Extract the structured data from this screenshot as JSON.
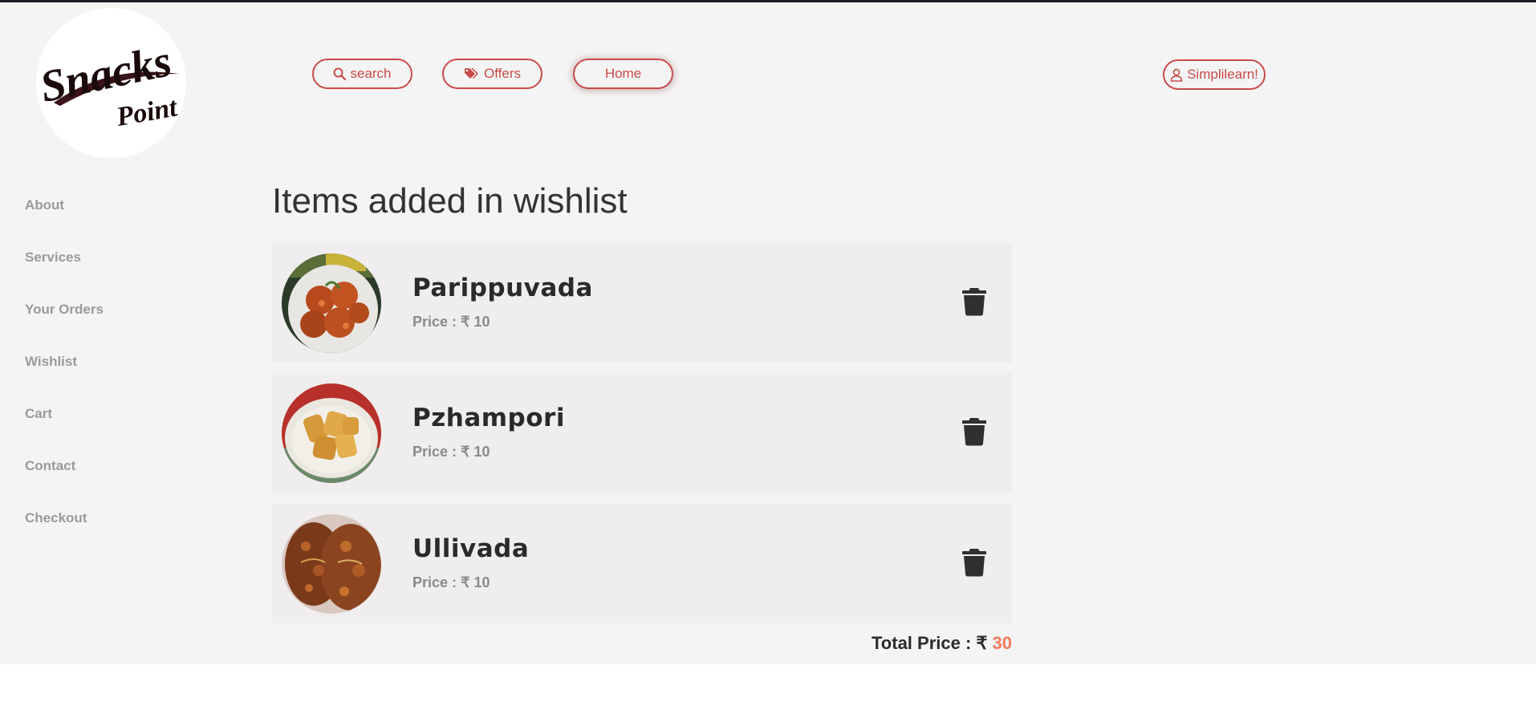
{
  "logo": {
    "line1": "Snacks",
    "line2": "Point"
  },
  "nav": {
    "search_label": "search",
    "offers_label": "Offers",
    "home_label": "Home",
    "user_label": "Simplilearn!"
  },
  "sidebar": {
    "items": [
      {
        "label": "About"
      },
      {
        "label": "Services"
      },
      {
        "label": "Your Orders"
      },
      {
        "label": "Wishlist"
      },
      {
        "label": "Cart"
      },
      {
        "label": "Contact"
      },
      {
        "label": "Checkout"
      }
    ]
  },
  "main": {
    "title": "Items added in wishlist",
    "items": [
      {
        "name": "Parippuvada",
        "price_label": "Price : ₹ 10"
      },
      {
        "name": "Pzhampori",
        "price_label": "Price : ₹ 10"
      },
      {
        "name": "Ullivada",
        "price_label": "Price : ₹ 10"
      }
    ],
    "total_label": "Total Price : ₹ ",
    "total_value": "30"
  },
  "colors": {
    "accent": "#c94a4a",
    "total_accent": "#f07a5c",
    "page_bg": "#f5f4f4",
    "card_bg": "#efeded"
  }
}
